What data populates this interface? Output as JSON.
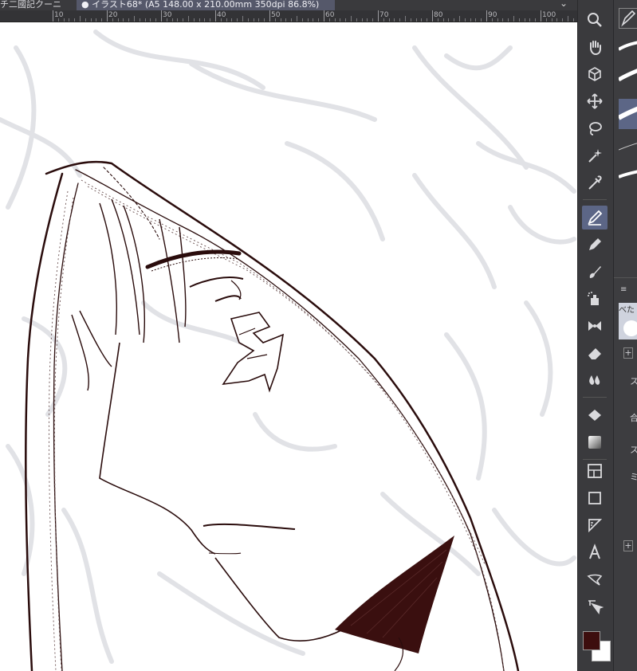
{
  "tabs": [
    {
      "label": "チ二國記クーニ"
    },
    {
      "label": "● イラスト68* (A5 148.00 x 210.00mm 350dpi 86.8%)"
    }
  ],
  "ruler": {
    "ticks": [
      "10",
      "20",
      "30",
      "40",
      "50",
      "60",
      "70",
      "80",
      "90",
      "100"
    ]
  },
  "tools": [
    {
      "icon": "zoom-icon"
    },
    {
      "icon": "hand-icon"
    },
    {
      "icon": "3d-cube-icon"
    },
    {
      "icon": "move-icon"
    },
    {
      "icon": "lasso-icon"
    },
    {
      "icon": "magic-wand-icon"
    },
    {
      "icon": "eyedropper-icon"
    },
    {
      "icon": "pen-icon",
      "active": true
    },
    {
      "icon": "pencil-icon"
    },
    {
      "icon": "brush-icon"
    },
    {
      "icon": "airbrush-icon"
    },
    {
      "icon": "decoration-icon"
    },
    {
      "icon": "eraser-icon"
    },
    {
      "icon": "blend-icon"
    },
    {
      "icon": "fill-icon"
    },
    {
      "icon": "gradient-icon"
    },
    {
      "icon": "frame-border-icon"
    },
    {
      "icon": "figure-icon"
    },
    {
      "icon": "ruler-icon"
    },
    {
      "icon": "text-icon"
    },
    {
      "icon": "balloon-icon"
    },
    {
      "icon": "operation-icon"
    }
  ],
  "colors": {
    "main": "#3d0e0e",
    "sub": "#ffffff",
    "accent": "#5c6686",
    "line": "#2a0c0c"
  },
  "subpanel": {
    "label_top": "べた",
    "plus_label": "+",
    "text_1": "ス",
    "text_2": "合",
    "text_3": "ス",
    "text_4": "ミ"
  }
}
